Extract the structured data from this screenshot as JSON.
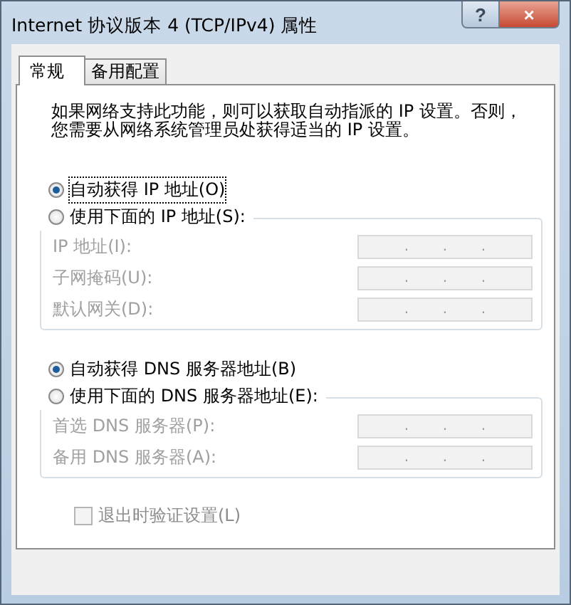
{
  "window": {
    "title": "Internet 协议版本 4 (TCP/IPv4) 属性",
    "help": "?",
    "close": "×"
  },
  "tabs": [
    {
      "label": "常规",
      "selected": true
    },
    {
      "label": "备用配置",
      "selected": false
    }
  ],
  "description": [
    "如果网络支持此功能，则可以获取自动指派的 IP 设置。否则，",
    "您需要从网络系统管理员处获得适当的 IP 设置。"
  ],
  "sections": [
    {
      "options": [
        {
          "label": "自动获得 IP 地址(O)",
          "selected": true,
          "focused": true
        },
        {
          "label": "使用下面的 IP 地址(S):",
          "selected": false,
          "focused": false
        }
      ],
      "fields": [
        {
          "label": "IP 地址(I):",
          "disabled": true,
          "separators": [
            ".",
            ".",
            "."
          ]
        },
        {
          "label": "子网掩码(U):",
          "disabled": true,
          "separators": [
            ".",
            ".",
            "."
          ]
        },
        {
          "label": "默认网关(D):",
          "disabled": true,
          "separators": [
            ".",
            ".",
            "."
          ]
        }
      ]
    },
    {
      "options": [
        {
          "label": "自动获得 DNS 服务器地址(B)",
          "selected": true,
          "focused": false
        },
        {
          "label": "使用下面的 DNS 服务器地址(E):",
          "selected": false,
          "focused": false
        }
      ],
      "fields": [
        {
          "label": "首选 DNS 服务器(P):",
          "disabled": true,
          "separators": [
            ".",
            ".",
            "."
          ]
        },
        {
          "label": "备用 DNS 服务器(A):",
          "disabled": true,
          "separators": [
            ".",
            ".",
            "."
          ]
        }
      ]
    }
  ],
  "checkbox": {
    "label": "退出时验证设置(L)",
    "checked": false,
    "disabled": true
  }
}
